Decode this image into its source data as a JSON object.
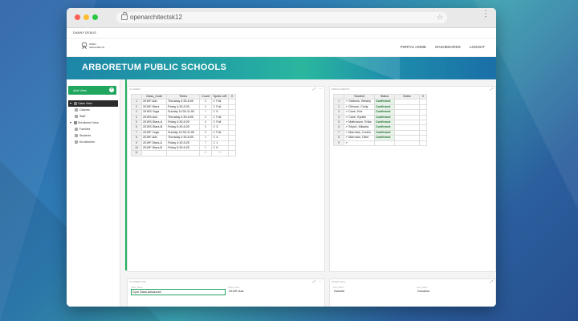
{
  "browser": {
    "url": "openarchitectsk12"
  },
  "app": {
    "user": "DANNY DEBUS",
    "logo_text": [
      "OPEN",
      "ARCHITECTS"
    ],
    "nav": [
      "PORTAL HOME",
      "DASHBOARDS",
      "LOGOUT"
    ],
    "banner_title": "ARBORETUM PUBLIC SCHOOLS",
    "accent": "#21a660"
  },
  "sidebar": {
    "add_view": "Add View",
    "items": [
      {
        "label": "Class View",
        "level": 0,
        "selected": true
      },
      {
        "label": "Classes",
        "level": 1
      },
      {
        "label": "Staff",
        "level": 1
      },
      {
        "label": "Enrollment View",
        "level": 0
      },
      {
        "label": "Families",
        "level": 1
      },
      {
        "label": "Students",
        "level": 1
      },
      {
        "label": "Enrollments",
        "level": 1
      }
    ]
  },
  "classes": {
    "title": "CLASSES",
    "columns": [
      "Class_Code",
      "Times",
      "Count",
      "Spots Left"
    ],
    "rows": [
      [
        "2019F-Adv",
        "Thursday 4:30-6:00",
        "8",
        "Full"
      ],
      [
        "2019F-Stars",
        "Friday 4:30-5:25",
        "8",
        "Full"
      ],
      [
        "2019S-Yoga",
        "Sunday 10:30-11:00",
        "7",
        "5"
      ],
      [
        "2019S-Adv",
        "Thursday 4:30-6:00",
        "8",
        "Full"
      ],
      [
        "2019S-Stars-A",
        "Friday 4:30-5:25",
        "8",
        "Full"
      ],
      [
        "2019S-Stars-B",
        "Friday 5:30-6:25",
        "5",
        "3"
      ],
      [
        "2019F-Yoga",
        "Sunday 10:30-11:00",
        "8",
        "Full"
      ],
      [
        "2019F-Adv",
        "Thursday 4:30-6:00",
        "4",
        "4"
      ],
      [
        "2019F-Stars-A",
        "Friday 4:30-5:25",
        "7",
        "1"
      ],
      [
        "2019F-Stars-B",
        "Friday 5:30-6:25",
        "2",
        "6"
      ]
    ],
    "blank_row": "11"
  },
  "enrollments": {
    "title": "ENROLLMENTS",
    "columns": [
      "Student",
      "Status",
      "Notes"
    ],
    "rows": [
      [
        "Gibbons, Wesley",
        "Confirmed"
      ],
      [
        "Gilmore, Cindy",
        "Confirmed"
      ],
      [
        "Cane, Kris",
        "Confirmed"
      ],
      [
        "Cane, Kyrstin",
        "Confirmed"
      ],
      [
        "Mathusson, Erika",
        "Confirmed"
      ],
      [
        "Strych, Mikaela",
        "Confirmed"
      ],
      [
        "Marrman, Corbin",
        "Confirmed"
      ],
      [
        "Marrman, Olive",
        "Confirmed"
      ]
    ],
    "blank_row": "9"
  },
  "classes_card": {
    "title": "CLASSES Card",
    "field1_label": "Class_Name",
    "field1_value": "Gym Stars Advanced",
    "field2_label": "Class_Code",
    "field2_value": "2019F-Adv"
  },
  "staff_card": {
    "title": "STAFF Card",
    "field1_label": "First_Name",
    "field1_value": "Danella",
    "field2_label": "Last_Name",
    "field2_value": "Dondelor"
  },
  "icons": {
    "expand": "expand-icon",
    "more": "more-icon"
  }
}
